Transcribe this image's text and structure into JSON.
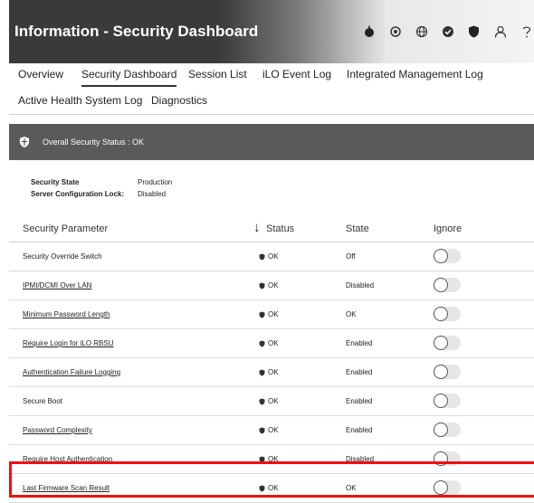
{
  "header": {
    "title": "Information - Security Dashboard",
    "icons": [
      "power-icon",
      "location-icon",
      "globe-icon",
      "check-circle-icon",
      "shield-icon",
      "user-icon",
      "help-icon"
    ]
  },
  "tabs_row1": [
    {
      "label": "Overview",
      "active": false
    },
    {
      "label": "Security Dashboard",
      "active": true
    },
    {
      "label": "Session List",
      "active": false
    },
    {
      "label": "iLO Event Log",
      "active": false
    },
    {
      "label": "Integrated Management Log",
      "active": false
    }
  ],
  "tabs_row2": [
    {
      "label": "Active Health System Log",
      "active": false
    },
    {
      "label": "Diagnostics",
      "active": false
    }
  ],
  "overall_status": {
    "text": "Overall Security Status : OK"
  },
  "security_info": {
    "state_label": "Security State",
    "state_value": "Production",
    "lock_label": "Server Configuration Lock:",
    "lock_value": "Disabled"
  },
  "table": {
    "headers": {
      "parameter": "Security Parameter",
      "status": "Status",
      "state": "State",
      "ignore": "Ignore"
    },
    "rows": [
      {
        "parameter": "Security Override Switch",
        "link": false,
        "status": "OK",
        "state": "Off"
      },
      {
        "parameter": "IPMI/DCMI Over LAN",
        "link": true,
        "status": "OK",
        "state": "Disabled"
      },
      {
        "parameter": "Minimum Password Length",
        "link": true,
        "status": "OK",
        "state": "OK"
      },
      {
        "parameter": "Require Login for iLO RBSU",
        "link": true,
        "status": "OK",
        "state": "Enabled"
      },
      {
        "parameter": "Authentication Failure Logging",
        "link": true,
        "status": "OK",
        "state": "Enabled"
      },
      {
        "parameter": "Secure Boot",
        "link": false,
        "status": "OK",
        "state": "Enabled"
      },
      {
        "parameter": "Password Complexity",
        "link": true,
        "status": "OK",
        "state": "Enabled"
      },
      {
        "parameter": "Require Host Authentication",
        "link": true,
        "status": "OK",
        "state": "Disabled"
      },
      {
        "parameter": "Last Firmware Scan Result",
        "link": true,
        "status": "OK",
        "state": "OK"
      }
    ]
  },
  "colors": {
    "header_dark": "#3a3a3a",
    "status_bar": "#5a5a5a",
    "highlight": "#ee1111"
  }
}
